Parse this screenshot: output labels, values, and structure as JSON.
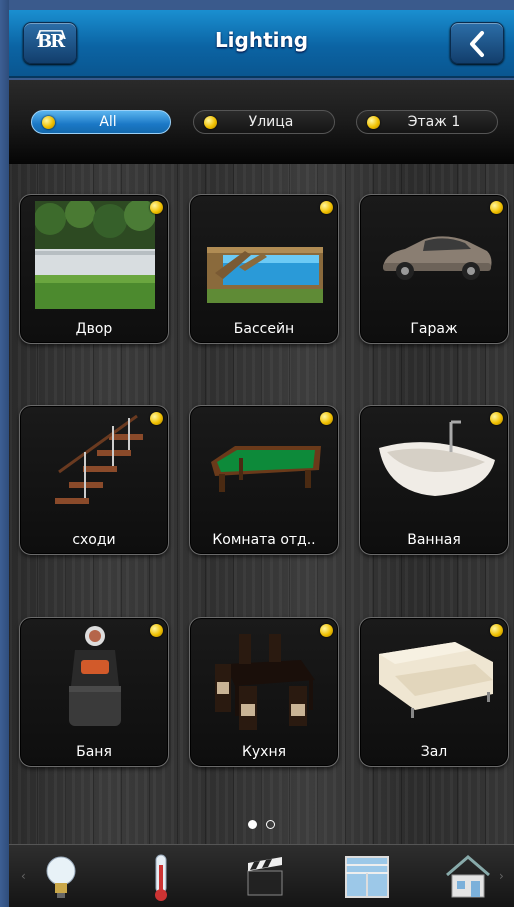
{
  "header": {
    "title": "Lighting",
    "logo_text": "BR",
    "back_icon": "chevron-left-icon"
  },
  "filters": [
    {
      "label": "All",
      "active": true
    },
    {
      "label": "Улица",
      "active": false
    },
    {
      "label": "Этаж 1",
      "active": false
    }
  ],
  "rooms": [
    {
      "label": "Двор",
      "icon": "yard-image",
      "light_on": true
    },
    {
      "label": "Бассейн",
      "icon": "pool-image",
      "light_on": true
    },
    {
      "label": "Гараж",
      "icon": "car-image",
      "light_on": true
    },
    {
      "label": "сходи",
      "icon": "stairs-image",
      "light_on": true
    },
    {
      "label": "Комната отд..",
      "icon": "billiard-table-image",
      "light_on": true
    },
    {
      "label": "Ванная",
      "icon": "bathtub-image",
      "light_on": true
    },
    {
      "label": "Баня",
      "icon": "sauna-stove-image",
      "light_on": true
    },
    {
      "label": "Кухня",
      "icon": "dining-table-image",
      "light_on": true
    },
    {
      "label": "Зал",
      "icon": "sofa-image",
      "light_on": true
    }
  ],
  "pager": {
    "pages": 2,
    "current": 1
  },
  "bottom_nav": [
    {
      "icon": "light-bulb-icon"
    },
    {
      "icon": "thermometer-icon"
    },
    {
      "icon": "clapperboard-icon"
    },
    {
      "icon": "window-blinds-icon"
    },
    {
      "icon": "house-icon"
    }
  ],
  "colors": {
    "header_blue": "#0b64a4",
    "accent_blue": "#1b78c6",
    "indicator_yellow": "#f0c000"
  }
}
